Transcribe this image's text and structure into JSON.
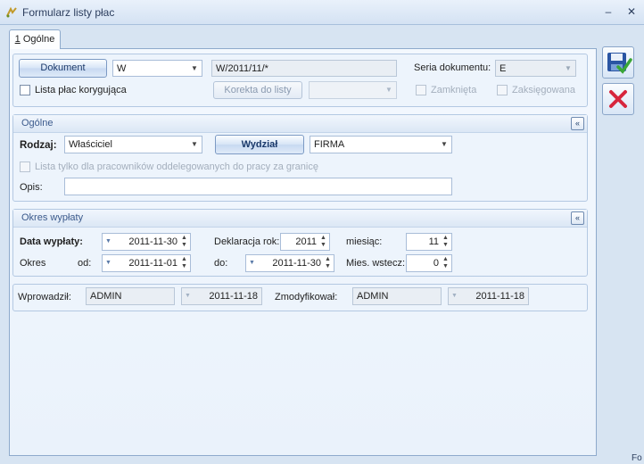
{
  "window": {
    "title": "Formularz listy płac",
    "minimize_glyph": "–",
    "close_glyph": "✕"
  },
  "tab": {
    "underline": "1",
    "rest": " Ogólne"
  },
  "header": {
    "dokument_button": "Dokument",
    "dokument_value": "W",
    "number_value": "W/2011/11/*",
    "seria_label": "Seria dokumentu:",
    "seria_value": "E",
    "korygujaca_label": "Lista płac korygująca",
    "korekta_button": "Korekta do listy",
    "korekta_value": "",
    "zamknieta_label": "Zamknięta",
    "zaksiegowana_label": "Zaksięgowana"
  },
  "ogolne": {
    "title": "Ogólne",
    "collapse_glyph": "«",
    "rodzaj_label": "Rodzaj:",
    "rodzaj_value": "Właściciel",
    "wydzial_button": "Wydział",
    "wydzial_value": "FIRMA",
    "oddelegowani_label": "Lista tylko dla pracowników oddelegowanych do pracy za granicę",
    "opis_label": "Opis:",
    "opis_value": ""
  },
  "okres": {
    "title": "Okres wypłaty",
    "collapse_glyph": "«",
    "data_wyplaty_label": "Data wypłaty:",
    "data_wyplaty_value": "2011-11-30",
    "deklaracja_label": "Deklaracja rok:",
    "deklaracja_value": "2011",
    "miesiac_label": "miesiąc:",
    "miesiac_value": "11",
    "okres_label": "Okres",
    "od_label": "od:",
    "od_value": "2011-11-01",
    "do_label": "do:",
    "do_value": "2011-11-30",
    "mies_wstecz_label": "Mies. wstecz:",
    "mies_wstecz_value": "0"
  },
  "footer": {
    "wprowadzil_label": "Wprowadził:",
    "wprowadzil_user": "ADMIN",
    "wprowadzil_date": "2011-11-18",
    "zmodyfikowal_label": "Zmodyfikował:",
    "zmodyfikowal_user": "ADMIN",
    "zmodyfikowal_date": "2011-11-18"
  },
  "side": {
    "corner_text": "Fo"
  },
  "icons": {
    "save": "save-icon",
    "cancel": "cancel-icon",
    "accent": "#d7263d",
    "save_color": "#2a55a3",
    "check_color": "#3aa636"
  }
}
